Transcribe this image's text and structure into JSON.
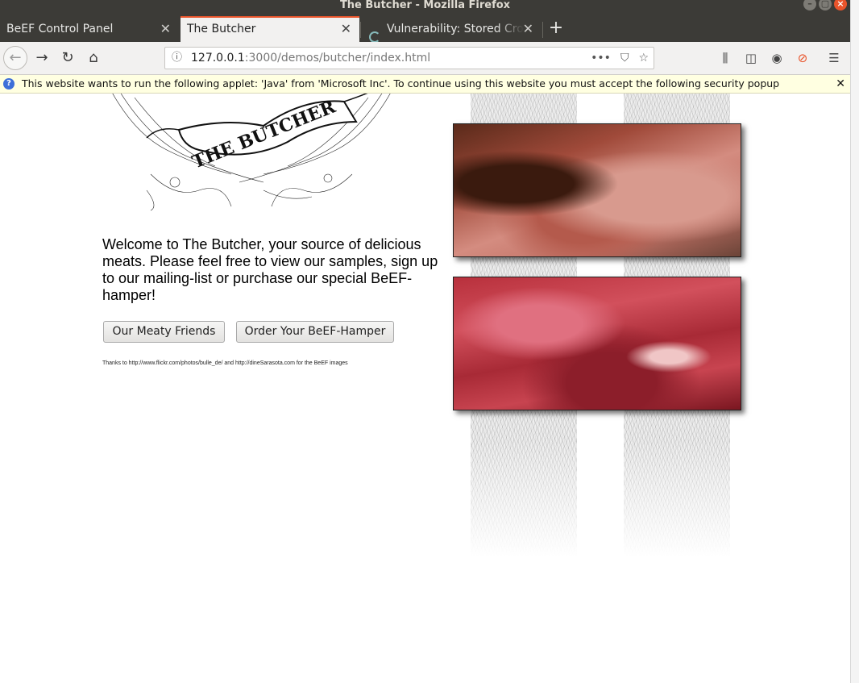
{
  "window": {
    "title": "The Butcher - Mozilla Firefox"
  },
  "tabs": [
    {
      "label": "BeEF Control Panel",
      "active": false
    },
    {
      "label": "The Butcher",
      "active": true
    },
    {
      "label": "Vulnerability: Stored Cross",
      "active": false
    }
  ],
  "navbar": {
    "url_host": "127.0.0.1",
    "url_path": ":3000/demos/butcher/index.html"
  },
  "notification": {
    "text": "This website wants to run the following applet: 'Java' from 'Microsoft Inc'. To continue using this website you must accept the following security popup"
  },
  "page": {
    "logo_text": "THE BUTCHER",
    "welcome": "Welcome to The Butcher, your source of delicious meats. Please feel free to view our samples, sign up to our mailing-list or purchase our special BeEF-hamper!",
    "buttons": {
      "friends": "Our Meaty Friends",
      "hamper": "Order Your BeEF-Hamper"
    },
    "credits": "Thanks to http://www.flickr.com/photos/bulle_de/ and http://dineSarasota.com for the BeEF images"
  },
  "colors": {
    "accent": "#e9542b",
    "chrome": "#3c3b37",
    "notification_bg": "#ffffe1"
  }
}
